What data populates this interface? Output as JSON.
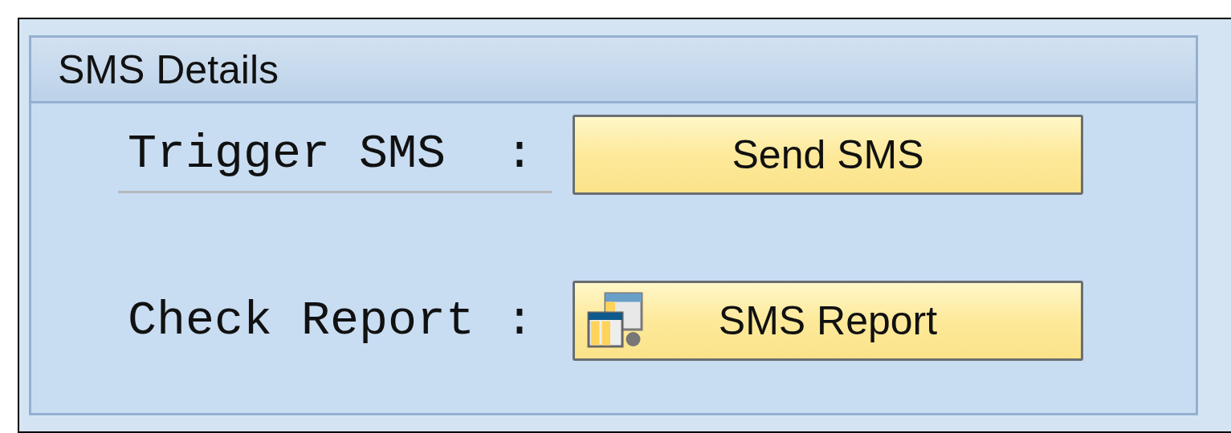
{
  "group": {
    "title": "SMS Details"
  },
  "rows": [
    {
      "label": "Trigger SMS",
      "separator": ":",
      "underlined": true,
      "button": {
        "label": "Send SMS",
        "icon": false
      }
    },
    {
      "label": "Check Report",
      "separator": ":",
      "underlined": false,
      "button": {
        "label": "SMS Report",
        "icon": true
      }
    }
  ]
}
